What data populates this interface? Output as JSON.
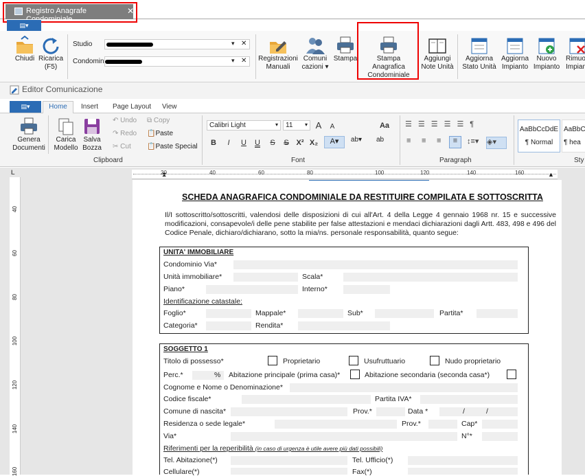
{
  "doc_tab": {
    "title": "Registro Anagrafe Condominiale",
    "close": "✕"
  },
  "app_menu_icon": "▤▾",
  "ribbon_top": {
    "chiudi": "Chiudi",
    "ricarica": [
      "Ricarica",
      "(F5)"
    ],
    "studio_label": "Studio",
    "condominio_label": "Condominio",
    "clear": "✕",
    "dropdown": "▾",
    "buttons": [
      {
        "id": "registrazioni",
        "lines": [
          "Registrazioni",
          "Manuali"
        ]
      },
      {
        "id": "comunicazioni",
        "lines": [
          "Comuni",
          "cazioni ▾"
        ]
      },
      {
        "id": "stampa",
        "lines": [
          "Stampa",
          ""
        ]
      },
      {
        "id": "stampa-anagrafica",
        "lines": [
          "Stampa Anagrafica",
          "Condominiale"
        ]
      },
      {
        "id": "aggiungi-note",
        "lines": [
          "Aggiungi",
          "Note Unità"
        ]
      },
      {
        "id": "aggiorna-stato",
        "lines": [
          "Aggiorna",
          "Stato Unità"
        ]
      },
      {
        "id": "aggiorna-impianto",
        "lines": [
          "Aggiorna",
          "Impianto"
        ]
      },
      {
        "id": "nuovo-impianto",
        "lines": [
          "Nuovo",
          "Impianto"
        ]
      },
      {
        "id": "rimuovi-impianto",
        "lines": [
          "Rimuov",
          "Impiant"
        ]
      }
    ]
  },
  "editor": {
    "title": "Editor Comunicazione"
  },
  "ribbon_tabs": {
    "file": "▤▾",
    "home": "Home",
    "insert": "Insert",
    "page_layout": "Page Layout",
    "view": "View"
  },
  "ribbon2": {
    "genera": [
      "Genera",
      "Documenti"
    ],
    "carica": [
      "Carica",
      "Modello"
    ],
    "salva": [
      "Salva",
      "Bozza"
    ],
    "undo": "Undo",
    "redo": "Redo",
    "cut": "Cut",
    "copy": "Copy",
    "paste": "Paste",
    "paste_special": "Paste Special",
    "clipboard_group": "Clipboard",
    "font_name": "Calibri Light",
    "font_size": "11",
    "font_group": "Font",
    "paragraph_group": "Paragraph",
    "style_sample": "AaBbCcDdE",
    "style_sample2": "AaBbC",
    "style_normal": "¶ Normal",
    "style_heading": "¶ hea",
    "styles_group": "Sty",
    "font_buttons": [
      "B",
      "I",
      "U",
      "U",
      "S",
      "S",
      "X²",
      "X₂"
    ],
    "grow": "A",
    "shrink": "A",
    "case": "Aa"
  },
  "ruler": {
    "h_labels": [
      "20",
      "40",
      "60",
      "80",
      "100",
      "120",
      "140",
      "160"
    ],
    "v_labels": [
      "40",
      "60",
      "80",
      "100",
      "120",
      "140",
      "160"
    ]
  },
  "document": {
    "title": "SCHEDA ANAGRAFICA CONDOMINIALE DA RESTITUIRE COMPILATA E SOTTOSCRITTA",
    "intro": "Il/I sottoscritto/sottoscritti, valendosi delle disposizioni di cui all'Art. 4 della Legge 4 gennaio 1968 nr. 15 e successive modificazioni, consapevole/i delle pene stabilite per false attestazioni e mendaci dichiarazioni dagli Artt. 483, 498 e 496 del Codice Penale, dichiaro/dichiarano, sotto la mia/ns. personale responsabilità, quanto segue:",
    "unita": {
      "title": "UNITA' IMMOBILIARE",
      "condominio_via": "Condominio Via*",
      "unita_immobiliare": "Unità immobiliare*",
      "scala": "Scala*",
      "piano": "Piano*",
      "interno": "Interno*",
      "identificazione": "Identificazione catastale:",
      "foglio": "Foglio*",
      "mappale": "Mappale*",
      "sub": "Sub*",
      "partita": "Partita*",
      "categoria": "Categoria*",
      "rendita": "Rendita*"
    },
    "soggetto": {
      "title": "SOGGETTO 1",
      "titolo_possesso": "Titolo di possesso*",
      "proprietario": "Proprietario",
      "usufruttuario": "Usufruttuario",
      "nudo_proprietario": "Nudo proprietario",
      "perc": "Perc.*",
      "percent_sign": "%",
      "abitazione_principale": "Abitazione principale (prima casa)*",
      "abitazione_secondaria": "Abitazione secondaria (seconda casa*)",
      "cognome_nome": "Cognome e Nome o Denominazione*",
      "codice_fiscale": "Codice fiscale*",
      "partita_iva": "Partita IVA*",
      "comune_nascita": "Comune di nascita*",
      "prov": "Prov.*",
      "data": "Data *",
      "slash": "/",
      "residenza": "Residenza o sede legale*",
      "prov2": "Prov.*",
      "cap": "Cap*",
      "via": "Via*",
      "numero": "N°*",
      "riferimenti": "Riferimenti per la reperibilità",
      "riferimenti_note": "(in caso di urgenza è utile avere più dati possibili)",
      "tel_abitazione": "Tel. Abitazione(*)",
      "tel_ufficio": "Tel. Ufficio(*)",
      "cellulare": "Cellulare(*)",
      "fax": "Fax(*)"
    }
  }
}
